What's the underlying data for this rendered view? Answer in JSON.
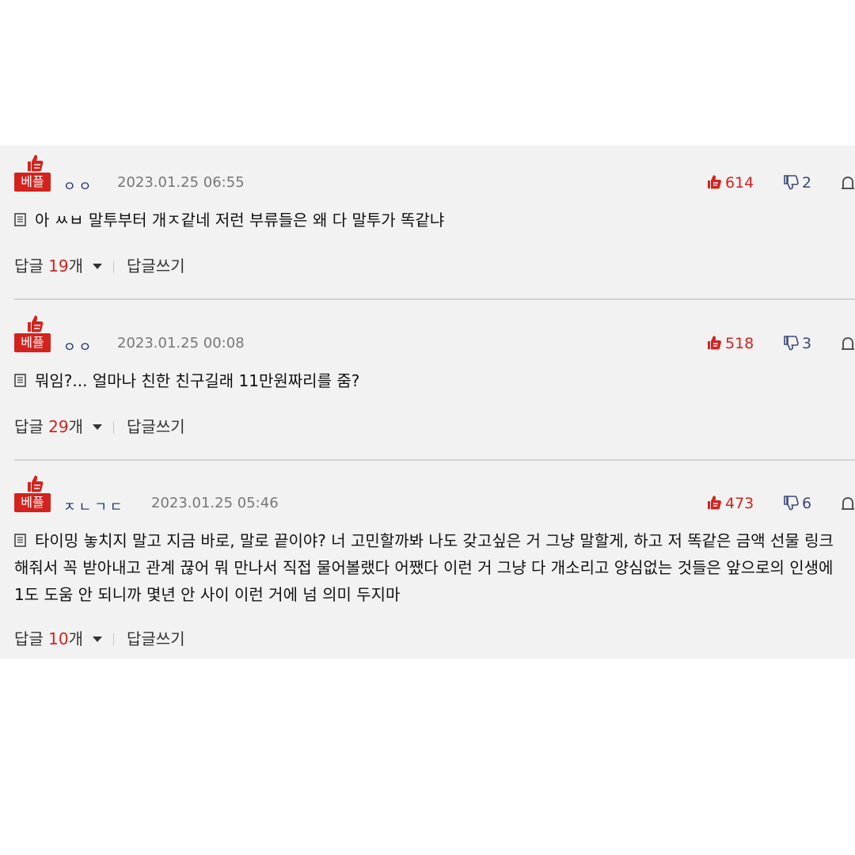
{
  "labels": {
    "best_badge": "베플",
    "reply_word": "답글",
    "count_suffix": "개",
    "write_reply": "답글쓰기"
  },
  "comments": [
    {
      "nickname": "ㅇㅇ",
      "date": "2023.01.25 06:55",
      "likes": "614",
      "dislikes": "2",
      "text": "아 ㅆㅂ 말투부터 개ㅈ같네 저런 부류들은 왜 다 말투가 똑같냐",
      "reply_count": "19"
    },
    {
      "nickname": "ㅇㅇ",
      "date": "2023.01.25 00:08",
      "likes": "518",
      "dislikes": "3",
      "text": "뭐임?... 얼마나 친한 친구길래 11만원짜리를 줌?",
      "reply_count": "29"
    },
    {
      "nickname": "ㅈㄴㄱㄷ",
      "date": "2023.01.25 05:46",
      "likes": "473",
      "dislikes": "6",
      "text": "타이밍 놓치지 말고 지금 바로, 말로 끝이야? 너 고민할까봐 나도 갖고싶은 거 그냥 말할게, 하고 저 똑같은 금액 선물 링크해줘서 꼭 받아내고 관계 끊어 뭐 만나서 직접 물어볼랬다 어쨌다 이런 거 그냥 다 개소리고 양심없는 것들은 앞으로의 인생에 1도 도움 안 되니까 몇년 안 사이 이런 거에 넘 의미 두지마",
      "reply_count": "10"
    }
  ],
  "icons": {
    "best": "thumbs-up-badge-icon",
    "like": "thumbs-up-icon",
    "dislike": "thumbs-down-icon",
    "report": "report-icon",
    "memo": "memo-icon",
    "caret": "caret-down-icon"
  },
  "colors": {
    "accent_red": "#d3231e",
    "nickname_navy": "#1b2f6b",
    "panel_bg": "#f2f2f2"
  }
}
